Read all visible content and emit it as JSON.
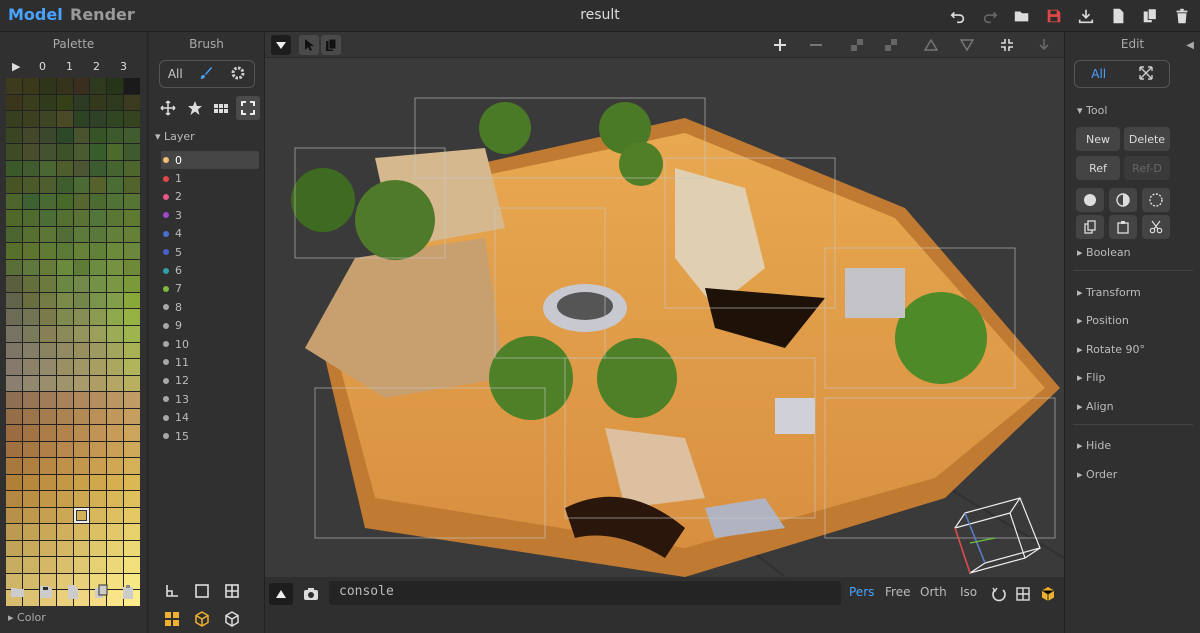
{
  "header": {
    "modes": [
      "Model",
      "Render"
    ],
    "title": "result",
    "icons": [
      "undo-icon",
      "redo-icon",
      "open-folder-icon",
      "save-icon",
      "download-icon",
      "new-file-icon",
      "duplicate-icon",
      "trash-icon"
    ]
  },
  "palette": {
    "title": "Palette",
    "columns": [
      "▶",
      "0",
      "1",
      "2",
      "3"
    ],
    "color_label": "Color",
    "selected_index": 212,
    "colors": [
      "#3d3b1e",
      "#3a3a1b",
      "#2e3518",
      "#35341a",
      "#3a2e1e",
      "#2d3a1e",
      "#263418",
      "#1a1a1a",
      "#39361c",
      "#3b3e1d",
      "#2f3b1a",
      "#354017",
      "#2e3b24",
      "#35391b",
      "#2d3a1b",
      "#3b3b20",
      "#364020",
      "#3c4021",
      "#3d4524",
      "#4a4a27",
      "#2c4424",
      "#2f4227",
      "#304522",
      "#35441f",
      "#3a4623",
      "#43482a",
      "#3b482b",
      "#2d4a28",
      "#48542e",
      "#365425",
      "#3d5a2c",
      "#415c2e",
      "#3e4b24",
      "#4a4d2b",
      "#45522f",
      "#3e5229",
      "#4a5c2f",
      "#375d2b",
      "#4c6a2b",
      "#3f5a2d",
      "#3a5a2a",
      "#405c2f",
      "#486532",
      "#4d5e2b",
      "#4a5732",
      "#3d5b30",
      "#456430",
      "#4c662e",
      "#475524",
      "#4a5a29",
      "#4f5e2f",
      "#3e5e2d",
      "#4b6a34",
      "#55622b",
      "#4a6d34",
      "#52622b",
      "#4b652d",
      "#3e6131",
      "#4a6a33",
      "#476a2a",
      "#55672e",
      "#4b6b30",
      "#517236",
      "#567534",
      "#506928",
      "#4f6b2e",
      "#4a6e35",
      "#547030",
      "#5a7233",
      "#52753a",
      "#5b7734",
      "#5e7a30",
      "#4b6530",
      "#56712f",
      "#5c7635",
      "#526e36",
      "#5c7a3a",
      "#59783a",
      "#62803a",
      "#658137",
      "#56702c",
      "#5e742f",
      "#5f7a33",
      "#5a7a36",
      "#668236",
      "#618038",
      "#6b8a3a",
      "#6a873c",
      "#5a6e38",
      "#5e783d",
      "#667c38",
      "#6a8a3c",
      "#5e7c36",
      "#6c8c40",
      "#74923f",
      "#6e8a38",
      "#5b5f3e",
      "#63703c",
      "#6c7a3f",
      "#6a8842",
      "#72894a",
      "#739245",
      "#7a9844",
      "#7a9a3a",
      "#61644a",
      "#6a6d40",
      "#747a44",
      "#7a8a48",
      "#72864a",
      "#7a944c",
      "#829e48",
      "#88a83a",
      "#6b6b56",
      "#727454",
      "#7a7a4a",
      "#7e8a4e",
      "#868e54",
      "#8a9a4e",
      "#8ea84c",
      "#96b244",
      "#767362",
      "#7a7b5a",
      "#868054",
      "#8a8a58",
      "#92945c",
      "#98a05a",
      "#9cac56",
      "#9eb44c",
      "#7d7566",
      "#847e66",
      "#8a8360",
      "#928a62",
      "#988e5e",
      "#9c9a60",
      "#a2a65c",
      "#a8b254",
      "#857a6c",
      "#8c826a",
      "#928a6a",
      "#9a9064",
      "#a09666",
      "#a89e62",
      "#aaa85e",
      "#b0b45a",
      "#8b7f70",
      "#928870",
      "#9a8e6c",
      "#a0946a",
      "#a89a6a",
      "#ae9e66",
      "#b4a664",
      "#b8b05e",
      "#8e6f52",
      "#977556",
      "#a07c58",
      "#a8825a",
      "#af885c",
      "#b48e5e",
      "#ba9662",
      "#be9c64",
      "#946e48",
      "#9c744a",
      "#a47c4e",
      "#ac8452",
      "#b48a54",
      "#ba9058",
      "#c0985c",
      "#c69e60",
      "#9a6c40",
      "#a27444",
      "#aa7c48",
      "#b2844c",
      "#b98c50",
      "#c09454",
      "#c69c58",
      "#cca45c",
      "#a07040",
      "#a87844",
      "#b08048",
      "#b8884c",
      "#be904e",
      "#c49852",
      "#caa056",
      "#d0a85a",
      "#a8783c",
      "#b08040",
      "#b88844",
      "#be9048",
      "#c4984c",
      "#caa050",
      "#d0a854",
      "#d6b058",
      "#b08038",
      "#b8883c",
      "#be9040",
      "#c49844",
      "#caa048",
      "#d0a84c",
      "#d6b050",
      "#dcb854",
      "#b48840",
      "#bc9044",
      "#c29848",
      "#c8a04c",
      "#cea850",
      "#d4b054",
      "#dab858",
      "#e0c05c",
      "#b89048",
      "#c0984c",
      "#c6a050",
      "#cca854",
      "#d2b058",
      "#d8b85c",
      "#dec060",
      "#e4c864",
      "#bc9a50",
      "#c4a254",
      "#caa858",
      "#d0b05c",
      "#d6b860",
      "#dcc064",
      "#e2c868",
      "#e8d06c",
      "#c2a458",
      "#c8aa5c",
      "#ceb060",
      "#d4b864",
      "#dac068",
      "#e0c86c",
      "#e6d070",
      "#ecd874",
      "#c8ac60",
      "#ceb264",
      "#d4b868",
      "#dac06c",
      "#e0c870",
      "#e6d074",
      "#ecd878",
      "#f2e07c",
      "#d0b468",
      "#d6ba6c",
      "#dcc070",
      "#e2c874",
      "#e8d078",
      "#eed87c",
      "#f4e080",
      "#f8e884",
      "#d8bc70",
      "#dec274",
      "#e4c878",
      "#eacf7c",
      "#f0d680",
      "#f6dc84",
      "#fae488",
      "#fcec8c"
    ],
    "tool_icons": [
      "open-icon",
      "save-icon",
      "new-icon",
      "copy-icon",
      "paste-icon"
    ]
  },
  "brush": {
    "title": "Brush",
    "segment": "All",
    "layer_label": "Layer",
    "layers": [
      {
        "name": "0",
        "color": "#f0c070"
      },
      {
        "name": "1",
        "color": "#e04848"
      },
      {
        "name": "2",
        "color": "#e85888"
      },
      {
        "name": "3",
        "color": "#a048c8"
      },
      {
        "name": "4",
        "color": "#4870d0"
      },
      {
        "name": "5",
        "color": "#4860c8"
      },
      {
        "name": "6",
        "color": "#30a0a8"
      },
      {
        "name": "7",
        "color": "#80b840"
      },
      {
        "name": "8",
        "color": "#a8a8a8"
      },
      {
        "name": "9",
        "color": "#a8a8a8"
      },
      {
        "name": "10",
        "color": "#a8a8a8"
      },
      {
        "name": "11",
        "color": "#a8a8a8"
      },
      {
        "name": "12",
        "color": "#a8a8a8"
      },
      {
        "name": "13",
        "color": "#a8a8a8"
      },
      {
        "name": "14",
        "color": "#a8a8a8"
      },
      {
        "name": "15",
        "color": "#a8a8a8"
      }
    ]
  },
  "viewport": {
    "console_placeholder": "console",
    "projections": [
      "Pers",
      "Free",
      "Orth",
      "Iso"
    ],
    "active_projection": "Pers"
  },
  "edit": {
    "title": "Edit",
    "segment": "All",
    "tool_label": "Tool",
    "buttons": {
      "new": "New",
      "delete": "Delete",
      "ref": "Ref",
      "refd": "Ref-D"
    },
    "sections": [
      "Boolean",
      "Transform",
      "Position",
      "Rotate 90°",
      "Flip",
      "Align",
      "Hide",
      "Order"
    ]
  },
  "accent": "#4aa3ff"
}
